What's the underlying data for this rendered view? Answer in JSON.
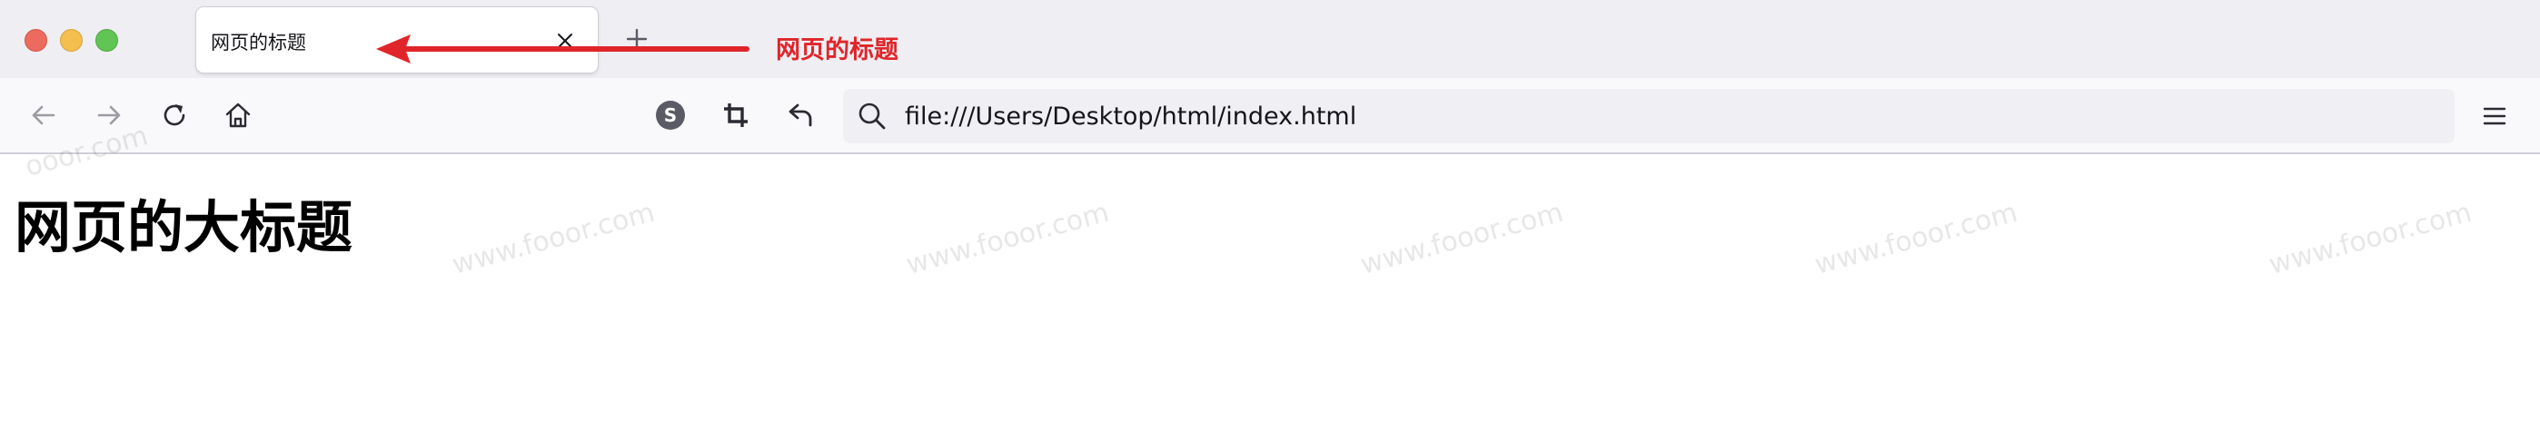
{
  "tab": {
    "title": "网页的标题",
    "close_glyph": "×",
    "new_tab_glyph": "+"
  },
  "annotation": {
    "text": "网页的标题",
    "color": "#e0252a"
  },
  "toolbar": {
    "icons": [
      "back-arrow-icon",
      "forward-arrow-icon",
      "reload-icon",
      "home-icon",
      "extension-s-icon",
      "crop-icon",
      "undo-icon",
      "search-icon",
      "hamburger-menu-icon"
    ],
    "extension_letter": "S"
  },
  "urlbar": {
    "url": "file:///Users/Desktop/html/index.html"
  },
  "page": {
    "heading": "网页的大标题"
  },
  "watermark": {
    "text": "www.fooor.com",
    "partial_text": "ooor.com"
  }
}
